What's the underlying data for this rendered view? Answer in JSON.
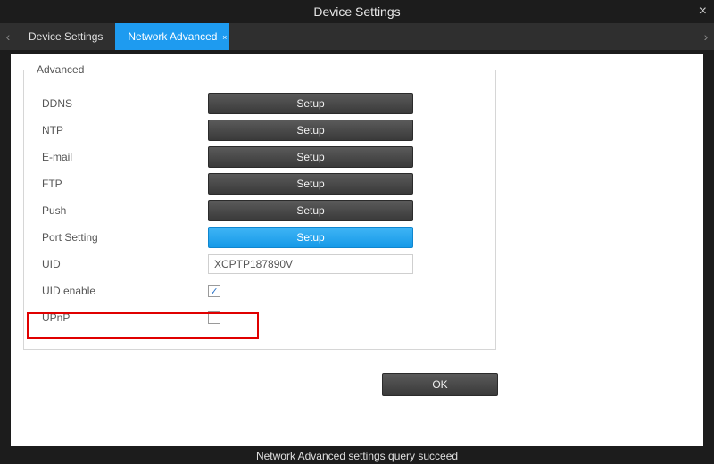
{
  "window": {
    "title": "Device Settings"
  },
  "tabs": {
    "items": [
      {
        "label": "Device Settings",
        "active": false
      },
      {
        "label": "Network Advanced",
        "active": true
      }
    ]
  },
  "panel": {
    "legend": "Advanced",
    "rows": [
      {
        "label": "DDNS",
        "kind": "button",
        "btn": "Setup",
        "highlight": false
      },
      {
        "label": "NTP",
        "kind": "button",
        "btn": "Setup",
        "highlight": false
      },
      {
        "label": "E-mail",
        "kind": "button",
        "btn": "Setup",
        "highlight": false
      },
      {
        "label": "FTP",
        "kind": "button",
        "btn": "Setup",
        "highlight": false
      },
      {
        "label": "Push",
        "kind": "button",
        "btn": "Setup",
        "highlight": false
      },
      {
        "label": "Port Setting",
        "kind": "button",
        "btn": "Setup",
        "highlight": true
      },
      {
        "label": "UID",
        "kind": "input",
        "value": "XCPTP187890V"
      },
      {
        "label": "UID enable",
        "kind": "checkbox",
        "checked": true
      },
      {
        "label": "UPnP",
        "kind": "checkbox",
        "checked": false
      }
    ]
  },
  "buttons": {
    "ok": "OK"
  },
  "status": "Network Advanced settings query succeed"
}
